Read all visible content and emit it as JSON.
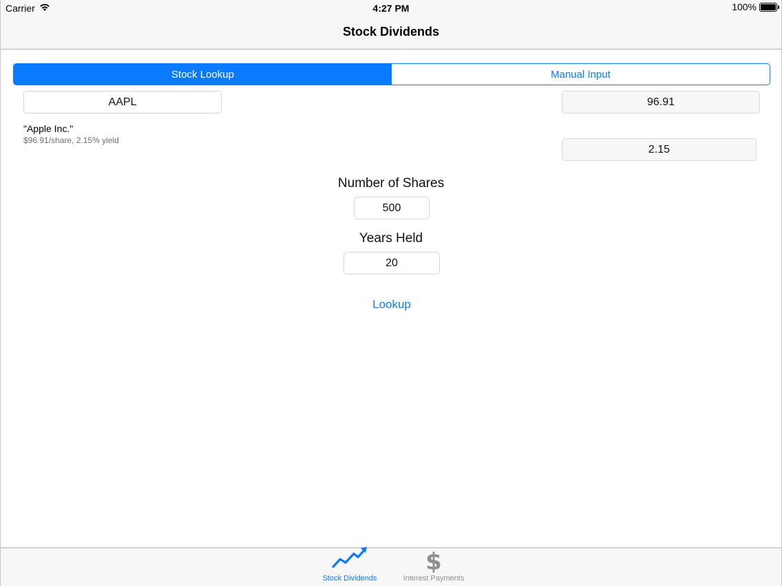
{
  "status_bar": {
    "carrier": "Carrier",
    "time": "4:27 PM",
    "battery": "100%",
    "battery_level": 1.0
  },
  "nav": {
    "title": "Stock Dividends"
  },
  "segmented_control": {
    "segments": [
      {
        "label": "Stock Lookup",
        "selected": true
      },
      {
        "label": "Manual Input",
        "selected": false
      }
    ]
  },
  "form": {
    "ticker": "AAPL",
    "price": "96.91",
    "yield": "2.15",
    "company_name": "\"Apple Inc.\"",
    "company_detail": "$96.91/share, 2.15% yield",
    "shares_label": "Number of Shares",
    "shares_value": "500",
    "years_label": "Years Held",
    "years_value": "20",
    "lookup_label": "Lookup"
  },
  "tab_bar": {
    "items": [
      {
        "label": "Stock Dividends",
        "icon": "trend-up-icon",
        "active": true
      },
      {
        "label": "Interest Payments",
        "icon": "dollar-icon",
        "active": false
      }
    ],
    "dollar_glyph": "$"
  },
  "colors": {
    "accent": "#0a7aff",
    "inactive": "#8e8e93",
    "bar_background": "#f7f7f7"
  }
}
